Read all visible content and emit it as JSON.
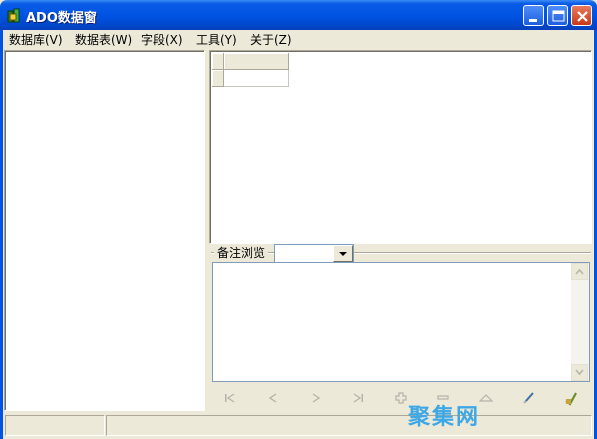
{
  "window": {
    "title": "ADO数据窗",
    "app_icon": "ado-database-icon"
  },
  "menu": {
    "items": [
      {
        "label": "数据库(V)"
      },
      {
        "label": "数据表(W)"
      },
      {
        "label": "字段(X)"
      },
      {
        "label": "工具(Y)"
      },
      {
        "label": "关于(Z)"
      }
    ]
  },
  "memo": {
    "label": "备注浏览",
    "selected": ""
  },
  "navigator": {
    "buttons": [
      {
        "name": "first-record-icon"
      },
      {
        "name": "prior-record-icon"
      },
      {
        "name": "next-record-icon"
      },
      {
        "name": "last-record-icon"
      },
      {
        "name": "insert-record-icon"
      },
      {
        "name": "delete-record-icon"
      },
      {
        "name": "edit-record-icon"
      },
      {
        "name": "post-edit-icon"
      },
      {
        "name": "cancel-edit-icon"
      }
    ]
  },
  "watermark": {
    "text": "聚集网"
  },
  "colors": {
    "titlebar": "#0054e3",
    "face": "#ece9d8",
    "watermark": "#3ea7e6"
  }
}
